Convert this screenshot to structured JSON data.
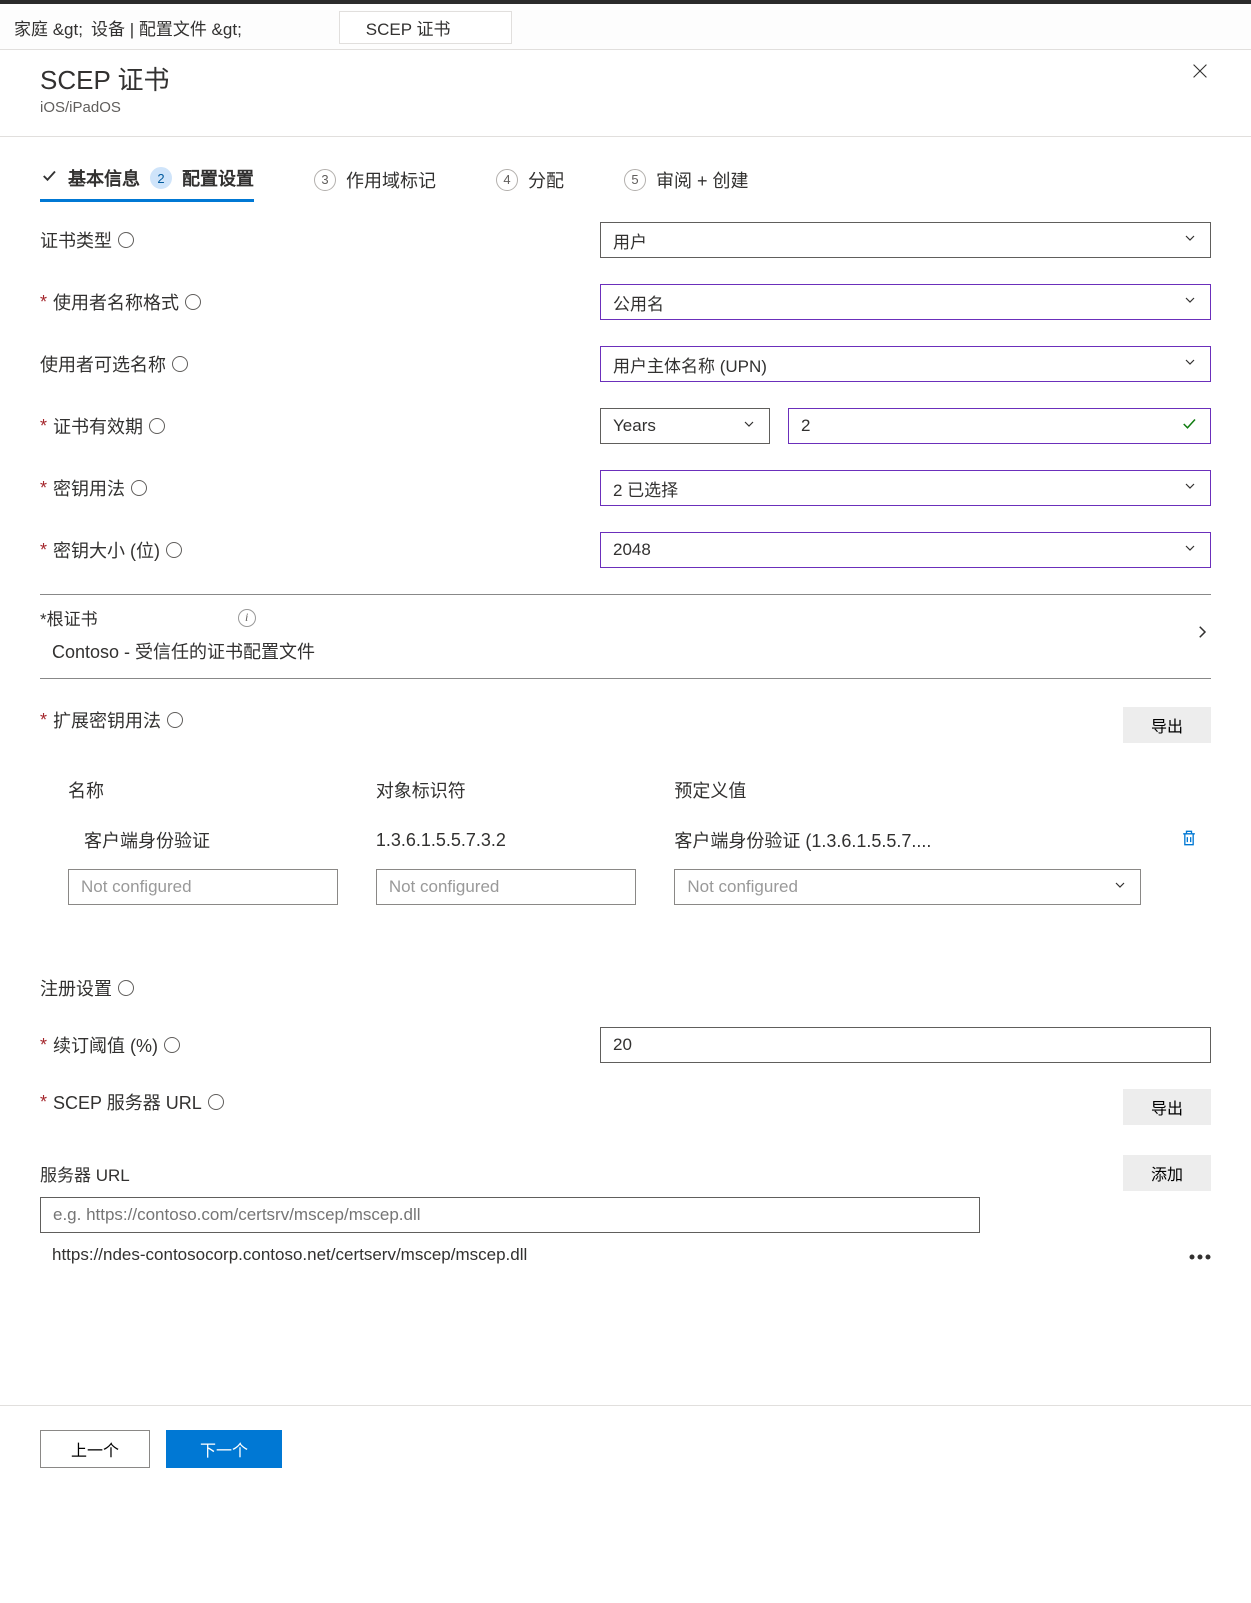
{
  "breadcrumb": {
    "home": "家庭 &gt;",
    "devices": "设备 | 配置文件 &gt;",
    "current": "SCEP 证书"
  },
  "header": {
    "title": "SCEP 证书",
    "subtitle": "iOS/iPadOS"
  },
  "wizard": {
    "step1": "基本信息",
    "step2_num": "2",
    "step2": "配置设置",
    "step3_num": "3",
    "step3": "作用域标记",
    "step4_num": "4",
    "step4": "分配",
    "step5_num": "5",
    "step5": "审阅 + 创建"
  },
  "form": {
    "cert_type_label": "证书类型",
    "cert_type_value": "用户",
    "subject_fmt_label": "使用者名称格式",
    "subject_fmt_value": "公用名",
    "san_label": "使用者可选名称",
    "san_value": "用户主体名称 (UPN)",
    "validity_label": "证书有效期",
    "validity_unit": "Years",
    "validity_value": "2",
    "keyusage_label": "密钥用法",
    "keyusage_value": "2 已选择",
    "keysize_label": "密钥大小 (位)",
    "keysize_value": "2048",
    "rootcert_label": "*根证书",
    "rootcert_value": "Contoso - 受信任的证书配置文件",
    "eku_label": "扩展密钥用法",
    "export_btn": "导出",
    "eku_cols": {
      "name": "名称",
      "oid": "对象标识符",
      "pred": "预定义值"
    },
    "eku_row": {
      "name": "客户端身份验证",
      "oid": "1.3.6.1.5.5.7.3.2",
      "pred": "客户端身份验证 (1.3.6.1.5.5.7...."
    },
    "not_configured": "Not configured",
    "enroll_label": "注册设置",
    "renew_label": "续订阈值 (%)",
    "renew_value": "20",
    "scep_url_label": "SCEP 服务器 URL",
    "server_url_label": "服务器 URL",
    "add_btn": "添加",
    "url_placeholder": "e.g. https://contoso.com/certsrv/mscep/mscep.dll",
    "url_entry": "https://ndes-contosocorp.contoso.net/certserv/mscep/mscep.dll"
  },
  "footer": {
    "prev": "上一个",
    "next": "下一个"
  }
}
